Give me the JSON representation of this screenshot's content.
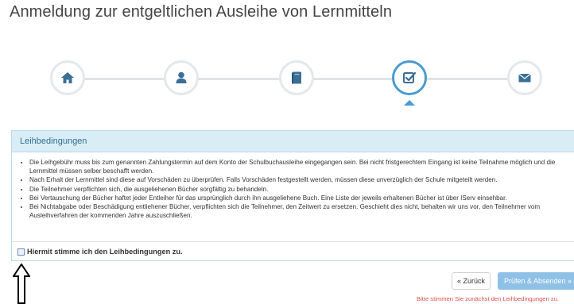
{
  "page": {
    "title": "Anmeldung zur entgeltlichen Ausleihe von Lernmitteln"
  },
  "wizard": {
    "steps": [
      {
        "icon": "home-icon",
        "state": "done"
      },
      {
        "icon": "user-icon",
        "state": "done"
      },
      {
        "icon": "book-icon",
        "state": "done"
      },
      {
        "icon": "checkbox-edit-icon",
        "state": "active"
      },
      {
        "icon": "envelope-icon",
        "state": "pending"
      }
    ],
    "colors": {
      "active": "#4a9cd0",
      "inactive": "#e4e8eb",
      "icon": "#3a6f96"
    }
  },
  "panel": {
    "heading": "Leihbedingungen",
    "rules": [
      "Die Leihgebühr muss bis zum genannten Zahlungstermin auf dem Konto der Schulbuchausleihe eingegangen sein. Bei nicht fristgerechtem Eingang ist keine Teilnahme möglich und die Lernmittel müssen selber beschafft werden.",
      "Nach Erhalt der Lernmittel sind diese auf Vorschäden zu überprüfen. Falls Vorschäden festgestellt werden, müssen diese unverzüglich der Schule mitgeteilt werden.",
      "Die Teilnehmer verpflichten sich, die ausgeliehenen Bücher sorgfältig zu behandeln.",
      "Bei Vertauschung der Bücher haftet jeder Entleiher für das ursprünglich durch ihn ausgeliehene Buch. Eine Liste der jeweils erhaltenen Bücher ist über IServ einsehbar.",
      "Bei Nichtabgabe oder Beschädigung entliehener Bücher, verpflichten sich die Teilnehmer, den Zeitwert zu ersetzen. Geschieht dies nicht, behalten wir uns vor, den Teilnehmer vom Ausleihverfahren der kommenden Jahre auszuschließen."
    ],
    "agree_label": "Hiermit stimme ich den Leihbedingungen zu.",
    "agree_checked": false,
    "heading_color": "#d9edf7"
  },
  "actions": {
    "back_label": "« Zurück",
    "submit_label": "Prüfen & Absenden »",
    "submit_color": "#8fc1e6"
  },
  "warning": "Bitte stimmen Sie zunächst den Leihbedingungen zu."
}
